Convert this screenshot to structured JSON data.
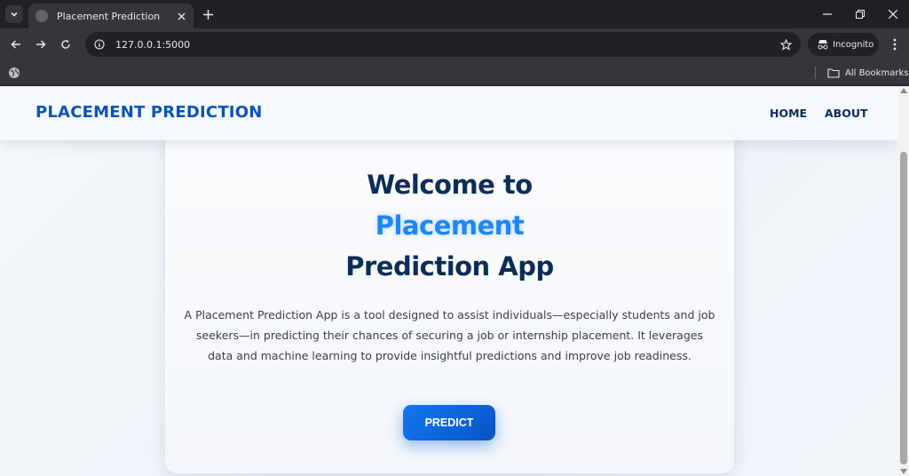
{
  "browser": {
    "tab": {
      "title": "Placement Prediction"
    },
    "address": {
      "url": "127.0.0.1:5000"
    },
    "incognito_label": "Incognito",
    "bookmarks": {
      "all_label": "All Bookmarks"
    }
  },
  "site": {
    "brand": "PLACEMENT PREDICTION",
    "nav": [
      {
        "label": "HOME"
      },
      {
        "label": "ABOUT"
      }
    ],
    "hero": {
      "line1": "Welcome to",
      "line2": "Placement",
      "line3": "Prediction App",
      "description": "A Placement Prediction App is a tool designed to assist individuals—especially students and job seekers—in predicting their chances of securing a job or internship placement. It leverages data and machine learning to provide insightful predictions and improve job readiness.",
      "button_label": "PREDICT"
    }
  },
  "colors": {
    "brand": "#0a54b8",
    "heading": "#0c2d57",
    "accent": "#1f86f2",
    "button": "#0e6ae0"
  },
  "icons": [
    "tab-search-icon",
    "globe-icon",
    "close-icon",
    "plus-icon",
    "minimize-icon",
    "restore-icon",
    "back-icon",
    "forward-icon",
    "reload-icon",
    "info-icon",
    "star-icon",
    "incognito-icon",
    "more-icon",
    "folder-icon"
  ]
}
